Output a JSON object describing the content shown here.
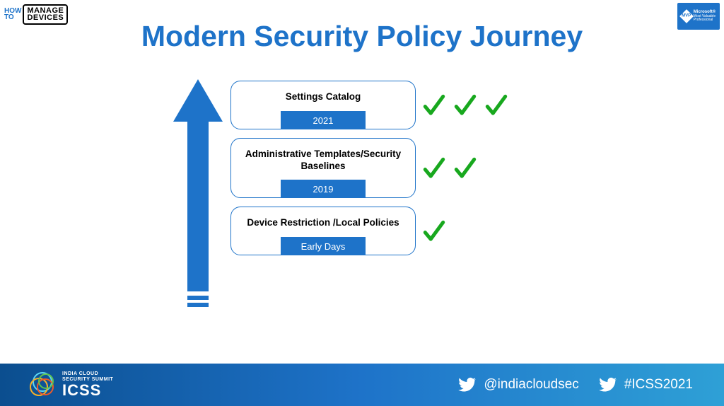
{
  "title": "Modern Security Policy Journey",
  "logos": {
    "htmd": {
      "how": "HOW",
      "to": "TO",
      "manage": "MANAGE",
      "devices": "DEVICES"
    },
    "mvp": {
      "brand": "Microsoft®",
      "line1": "Most Valuable",
      "line2": "Professional",
      "badge": "MVP"
    }
  },
  "stages": [
    {
      "title": "Settings Catalog",
      "year": "2021",
      "checks": 3
    },
    {
      "title": "Administrative Templates/Security Baselines",
      "year": "2019",
      "checks": 2
    },
    {
      "title": "Device Restriction /Local Policies",
      "year": "Early Days",
      "checks": 1
    }
  ],
  "footer": {
    "summit_line1": "INDIA CLOUD",
    "summit_line2": "SECURITY SUMMIT",
    "summit_acronym": "ICSS",
    "twitter_handle": "@indiacloudsec",
    "hashtag": "#ICSS2021"
  },
  "colors": {
    "primary": "#1e73c9",
    "check": "#18a81e"
  }
}
